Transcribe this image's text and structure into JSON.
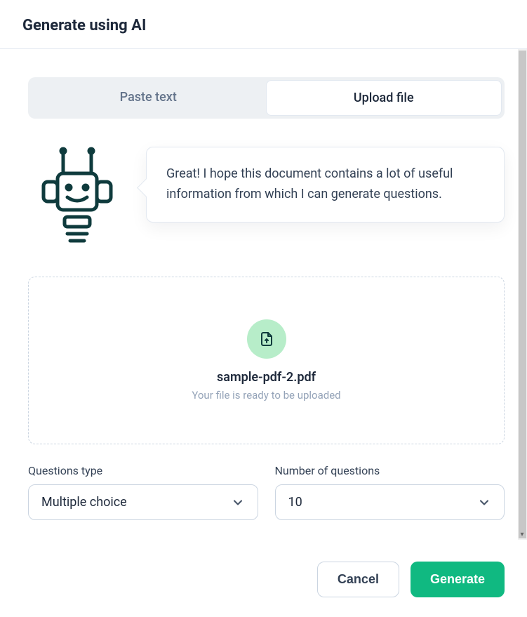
{
  "header": {
    "title": "Generate using AI"
  },
  "tabs": {
    "paste": "Paste text",
    "upload": "Upload file"
  },
  "assistant": {
    "message": "Great! I hope this document contains a lot of useful information from which I can generate questions."
  },
  "upload": {
    "filename": "sample-pdf-2.pdf",
    "status": "Your file is ready to be uploaded"
  },
  "form": {
    "questionType": {
      "label": "Questions type",
      "value": "Multiple choice"
    },
    "numberOfQuestions": {
      "label": "Number of questions",
      "value": "10"
    }
  },
  "footer": {
    "cancel": "Cancel",
    "generate": "Generate"
  },
  "colors": {
    "primary": "#10b981",
    "iconBg": "#b7edc9",
    "robotStroke": "#0f3b3d",
    "textMuted": "#94a3b8"
  }
}
